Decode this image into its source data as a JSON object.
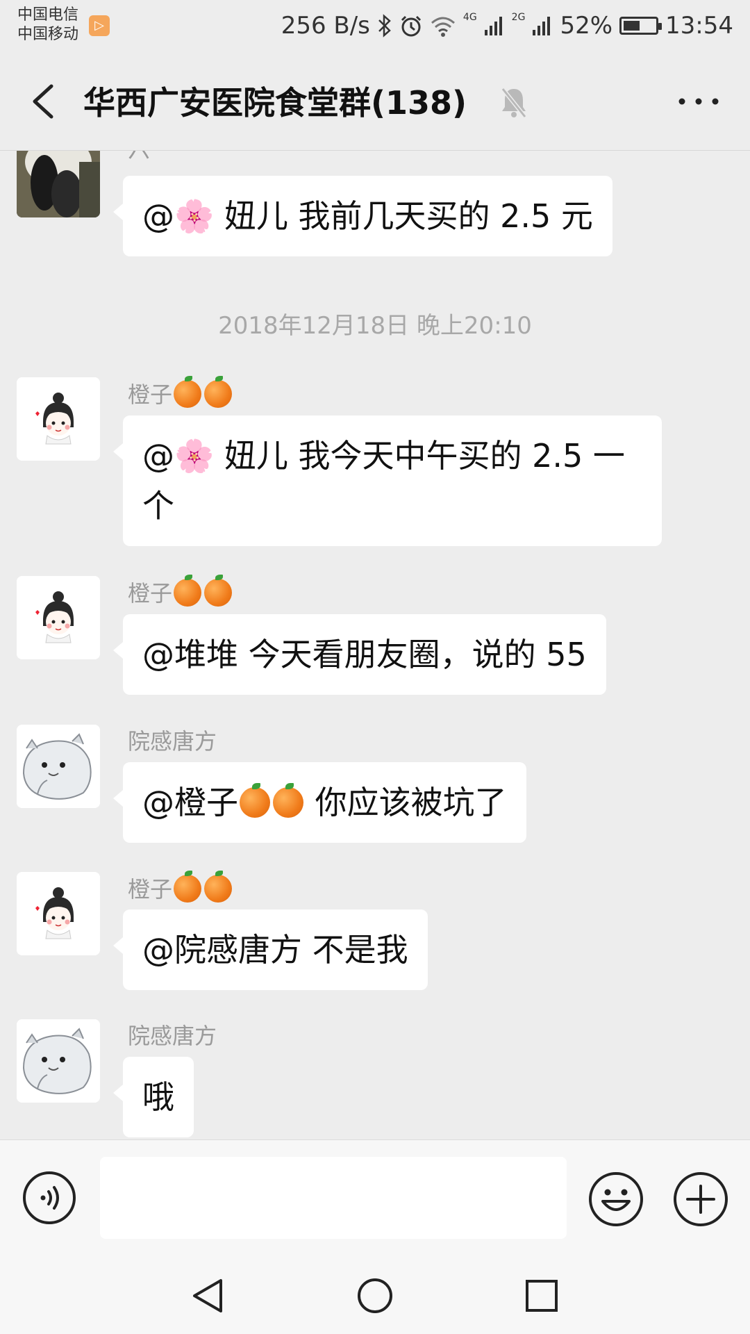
{
  "status": {
    "carrier1": "中国电信",
    "carrier2": "中国移动",
    "speed": "256 B/s",
    "signal1": "4G",
    "signal2": "2G",
    "battery": "52%",
    "battery_level": 0.52,
    "time": "13:54"
  },
  "header": {
    "title": "华西广安医院食堂群(138)"
  },
  "messages": [
    {
      "sender": "六一",
      "text_prefix": "@🌸 妞儿  我前几天买的 2.5 元"
    },
    {
      "timestamp": "2018年12月18日 晚上20:10"
    },
    {
      "sender": "橙子",
      "text": "@🌸 妞儿  我今天中午买的 2.5 一个"
    },
    {
      "sender": "橙子",
      "text": "@堆堆  今天看朋友圈，说的 55"
    },
    {
      "sender": "院感唐方",
      "text_a": "@橙子",
      "text_b": " 你应该被坑了"
    },
    {
      "sender": "橙子",
      "text": "@院感唐方  不是我"
    },
    {
      "sender": "院感唐方",
      "text": "哦"
    }
  ],
  "input": {
    "value": ""
  },
  "colors": {
    "background": "#ededed",
    "bubble": "#ffffff",
    "sender": "#9a9a9a"
  }
}
